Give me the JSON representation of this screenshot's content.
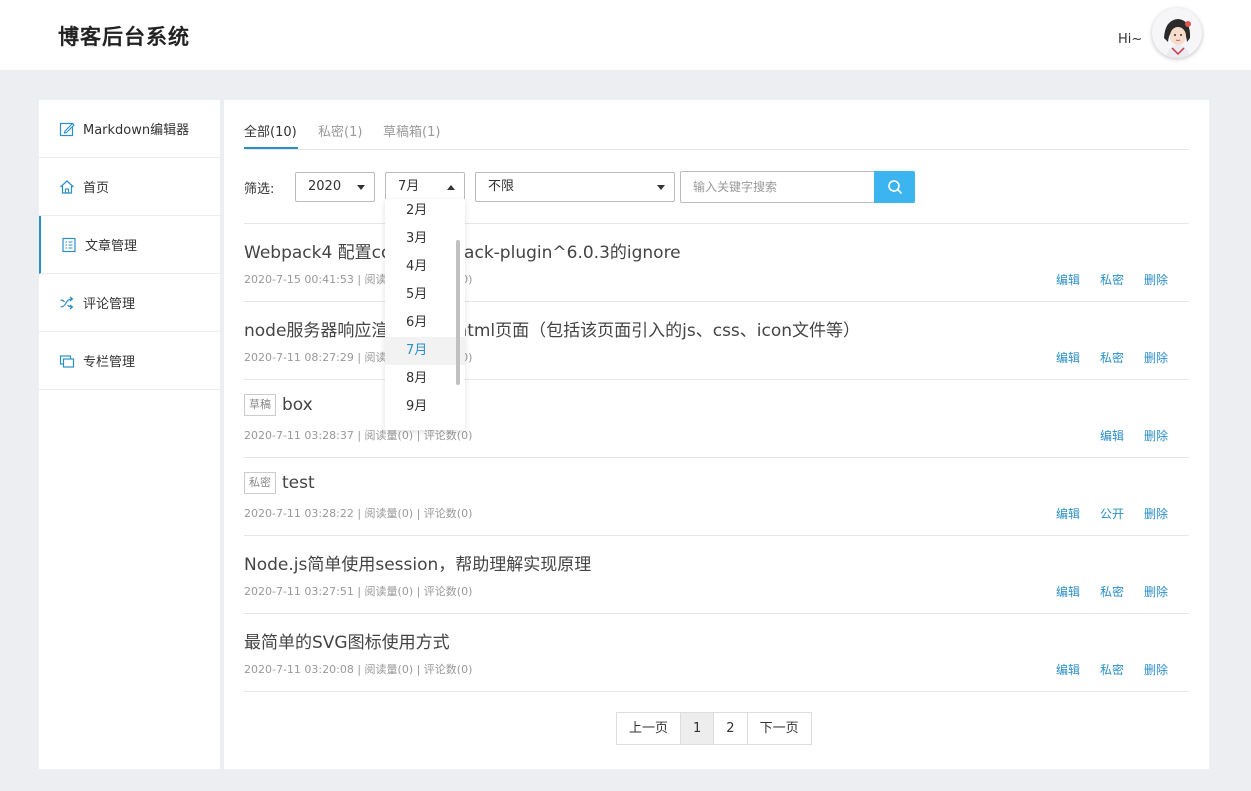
{
  "header": {
    "brand": "博客后台系统",
    "greeting": "Hi~"
  },
  "sidebar": {
    "items": [
      {
        "label": "Markdown编辑器",
        "icon": "edit-icon"
      },
      {
        "label": "首页",
        "icon": "home-icon"
      },
      {
        "label": "文章管理",
        "icon": "article-list-icon",
        "active": true
      },
      {
        "label": "评论管理",
        "icon": "comment-icon"
      },
      {
        "label": "专栏管理",
        "icon": "column-icon"
      }
    ]
  },
  "tabs": [
    {
      "label": "全部(10)",
      "active": true
    },
    {
      "label": "私密(1)"
    },
    {
      "label": "草稿箱(1)"
    }
  ],
  "filter": {
    "label": "筛选:",
    "year": "2020",
    "month": "7月",
    "category": "不限",
    "search_placeholder": "输入关键字搜索"
  },
  "month_dropdown": {
    "options": [
      "2月",
      "3月",
      "4月",
      "5月",
      "6月",
      "7月",
      "8月",
      "9月"
    ],
    "selected": "7月"
  },
  "articles": [
    {
      "title": "Webpack4 配置copy-webpack-plugin^6.0.3的ignore",
      "tag": "",
      "meta": "2020-7-15 00:41:53 | 阅读量(0) | 评论数(0)",
      "actions": [
        "编辑",
        "私密",
        "删除"
      ]
    },
    {
      "title": "node服务器响应渲染静态的html页面（包括该页面引入的js、css、icon文件等）",
      "tag": "",
      "meta": "2020-7-11 08:27:29 | 阅读量(0) | 评论数(0)",
      "actions": [
        "编辑",
        "私密",
        "删除"
      ]
    },
    {
      "title": "box",
      "tag": "草稿",
      "meta": "2020-7-11 03:28:37 | 阅读量(0) | 评论数(0)",
      "actions": [
        "编辑",
        "删除"
      ]
    },
    {
      "title": "test",
      "tag": "私密",
      "meta": "2020-7-11 03:28:22 | 阅读量(0) | 评论数(0)",
      "actions": [
        "编辑",
        "公开",
        "删除"
      ]
    },
    {
      "title": "Node.js简单使用session，帮助理解实现原理",
      "tag": "",
      "meta": "2020-7-11 03:27:51 | 阅读量(0) | 评论数(0)",
      "actions": [
        "编辑",
        "私密",
        "删除"
      ]
    },
    {
      "title": "最简单的SVG图标使用方式",
      "tag": "",
      "meta": "2020-7-11 03:20:08 | 阅读量(0) | 评论数(0)",
      "actions": [
        "编辑",
        "私密",
        "删除"
      ]
    }
  ],
  "pagination": {
    "prev": "上一页",
    "pages": [
      "1",
      "2"
    ],
    "current": "1",
    "next": "下一页"
  },
  "colors": {
    "accent": "#2b8fc7",
    "search_button": "#3bb4ef",
    "page_bg": "#eceef2"
  }
}
